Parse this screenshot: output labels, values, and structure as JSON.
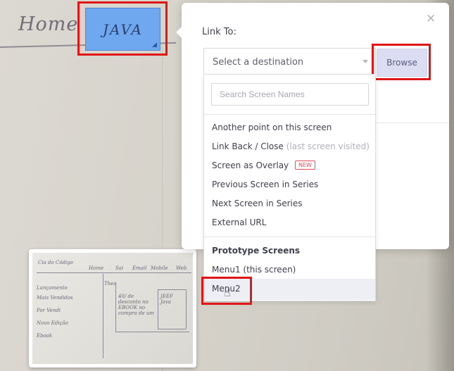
{
  "canvas": {
    "home_label": "Home",
    "selected_hotspot_label": "JAVA",
    "thumbnail": {
      "texts": [
        "Cia do Código",
        "Home",
        "Sai",
        "Email",
        "Mobile",
        "Web",
        "Lançamento",
        "Mais Vendidos",
        "Por Vendi",
        "Novo Edição",
        "Ebook",
        "Thea",
        "40/ de desconto no EBOOK no compra de um",
        "JEEF Java"
      ]
    }
  },
  "popover": {
    "link_to_label": "Link To:",
    "close_label": "×",
    "destination_select": {
      "placeholder": "Select a destination"
    },
    "browse_label": "Browse"
  },
  "dropdown": {
    "search_placeholder": "Search Screen Names",
    "link_options": [
      {
        "label": "Another point on this screen",
        "hint": ""
      },
      {
        "label": "Link Back / Close",
        "hint": "(last screen visited)"
      },
      {
        "label": "Screen as Overlay",
        "hint": "",
        "badge": "NEW"
      },
      {
        "label": "Previous Screen in Series",
        "hint": ""
      },
      {
        "label": "Next Screen in Series",
        "hint": ""
      },
      {
        "label": "External URL",
        "hint": ""
      }
    ],
    "prototype_heading": "Prototype Screens",
    "screens": [
      {
        "label": "Menu1 (this screen)"
      },
      {
        "label": "Menu2"
      }
    ]
  },
  "colors": {
    "highlight_outline": "#e01616",
    "hotspot_fill": "#6fa8ee",
    "browse_button": "#dcdcf2",
    "new_badge": "#e74b5a"
  }
}
